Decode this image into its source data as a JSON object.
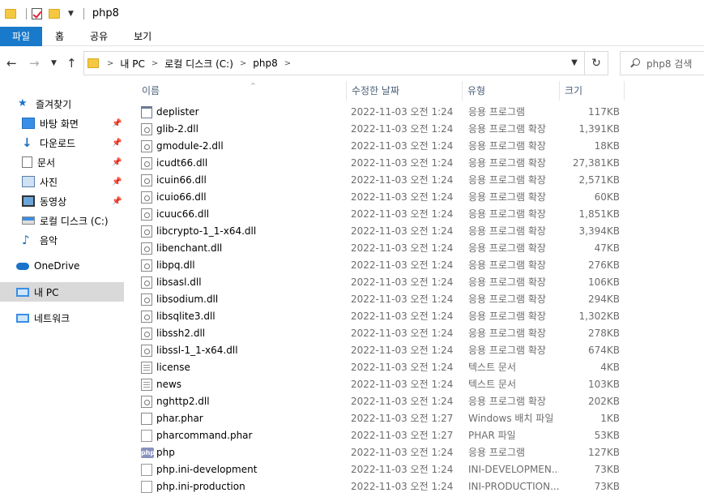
{
  "window": {
    "title": "php8"
  },
  "ribbon": {
    "tabs": [
      "파일",
      "홈",
      "공유",
      "보기"
    ]
  },
  "address": {
    "parts": [
      "내 PC",
      "로컬 디스크 (C:)",
      "php8"
    ],
    "search_placeholder": "php8 검색"
  },
  "sidebar": {
    "items": [
      {
        "label": "즐겨찾기",
        "icon": "star-icon",
        "pinned": false
      },
      {
        "label": "바탕 화면",
        "icon": "desktop-icon",
        "pinned": true
      },
      {
        "label": "다운로드",
        "icon": "download-icon",
        "pinned": true
      },
      {
        "label": "문서",
        "icon": "document-icon",
        "pinned": true
      },
      {
        "label": "사진",
        "icon": "picture-icon",
        "pinned": true
      },
      {
        "label": "동영상",
        "icon": "video-icon",
        "pinned": true
      },
      {
        "label": "로컬 디스크 (C:)",
        "icon": "drive-icon",
        "pinned": false
      },
      {
        "label": "음악",
        "icon": "music-icon",
        "pinned": false
      },
      {
        "label": "OneDrive",
        "icon": "cloud-icon",
        "pinned": false
      },
      {
        "label": "내 PC",
        "icon": "computer-icon",
        "pinned": false
      },
      {
        "label": "네트워크",
        "icon": "network-icon",
        "pinned": false
      }
    ]
  },
  "columns": {
    "name": "이름",
    "date": "수정한 날짜",
    "type": "유형",
    "size": "크기"
  },
  "files": [
    {
      "name": "deplister",
      "date": "2022-11-03 오전 1:24",
      "type": "응용 프로그램",
      "size": "117KB",
      "icon": "exe"
    },
    {
      "name": "glib-2.dll",
      "date": "2022-11-03 오전 1:24",
      "type": "응용 프로그램 확장",
      "size": "1,391KB",
      "icon": "dll"
    },
    {
      "name": "gmodule-2.dll",
      "date": "2022-11-03 오전 1:24",
      "type": "응용 프로그램 확장",
      "size": "18KB",
      "icon": "dll"
    },
    {
      "name": "icudt66.dll",
      "date": "2022-11-03 오전 1:24",
      "type": "응용 프로그램 확장",
      "size": "27,381KB",
      "icon": "dll"
    },
    {
      "name": "icuin66.dll",
      "date": "2022-11-03 오전 1:24",
      "type": "응용 프로그램 확장",
      "size": "2,571KB",
      "icon": "dll"
    },
    {
      "name": "icuio66.dll",
      "date": "2022-11-03 오전 1:24",
      "type": "응용 프로그램 확장",
      "size": "60KB",
      "icon": "dll"
    },
    {
      "name": "icuuc66.dll",
      "date": "2022-11-03 오전 1:24",
      "type": "응용 프로그램 확장",
      "size": "1,851KB",
      "icon": "dll"
    },
    {
      "name": "libcrypto-1_1-x64.dll",
      "date": "2022-11-03 오전 1:24",
      "type": "응용 프로그램 확장",
      "size": "3,394KB",
      "icon": "dll"
    },
    {
      "name": "libenchant.dll",
      "date": "2022-11-03 오전 1:24",
      "type": "응용 프로그램 확장",
      "size": "47KB",
      "icon": "dll"
    },
    {
      "name": "libpq.dll",
      "date": "2022-11-03 오전 1:24",
      "type": "응용 프로그램 확장",
      "size": "276KB",
      "icon": "dll"
    },
    {
      "name": "libsasl.dll",
      "date": "2022-11-03 오전 1:24",
      "type": "응용 프로그램 확장",
      "size": "106KB",
      "icon": "dll"
    },
    {
      "name": "libsodium.dll",
      "date": "2022-11-03 오전 1:24",
      "type": "응용 프로그램 확장",
      "size": "294KB",
      "icon": "dll"
    },
    {
      "name": "libsqlite3.dll",
      "date": "2022-11-03 오전 1:24",
      "type": "응용 프로그램 확장",
      "size": "1,302KB",
      "icon": "dll"
    },
    {
      "name": "libssh2.dll",
      "date": "2022-11-03 오전 1:24",
      "type": "응용 프로그램 확장",
      "size": "278KB",
      "icon": "dll"
    },
    {
      "name": "libssl-1_1-x64.dll",
      "date": "2022-11-03 오전 1:24",
      "type": "응용 프로그램 확장",
      "size": "674KB",
      "icon": "dll"
    },
    {
      "name": "license",
      "date": "2022-11-03 오전 1:24",
      "type": "텍스트 문서",
      "size": "4KB",
      "icon": "txt"
    },
    {
      "name": "news",
      "date": "2022-11-03 오전 1:24",
      "type": "텍스트 문서",
      "size": "103KB",
      "icon": "txt"
    },
    {
      "name": "nghttp2.dll",
      "date": "2022-11-03 오전 1:24",
      "type": "응용 프로그램 확장",
      "size": "202KB",
      "icon": "dll"
    },
    {
      "name": "phar.phar",
      "date": "2022-11-03 오전 1:27",
      "type": "Windows 배치 파일",
      "size": "1KB",
      "icon": "phar"
    },
    {
      "name": "pharcommand.phar",
      "date": "2022-11-03 오전 1:27",
      "type": "PHAR 파일",
      "size": "53KB",
      "icon": "blank"
    },
    {
      "name": "php",
      "date": "2022-11-03 오전 1:24",
      "type": "응용 프로그램",
      "size": "127KB",
      "icon": "php",
      "icon_text": "php"
    },
    {
      "name": "php.ini-development",
      "date": "2022-11-03 오전 1:24",
      "type": "INI-DEVELOPMEN...",
      "size": "73KB",
      "icon": "blank"
    },
    {
      "name": "php.ini-production",
      "date": "2022-11-03 오전 1:24",
      "type": "INI-PRODUCTION...",
      "size": "73KB",
      "icon": "blank"
    }
  ]
}
